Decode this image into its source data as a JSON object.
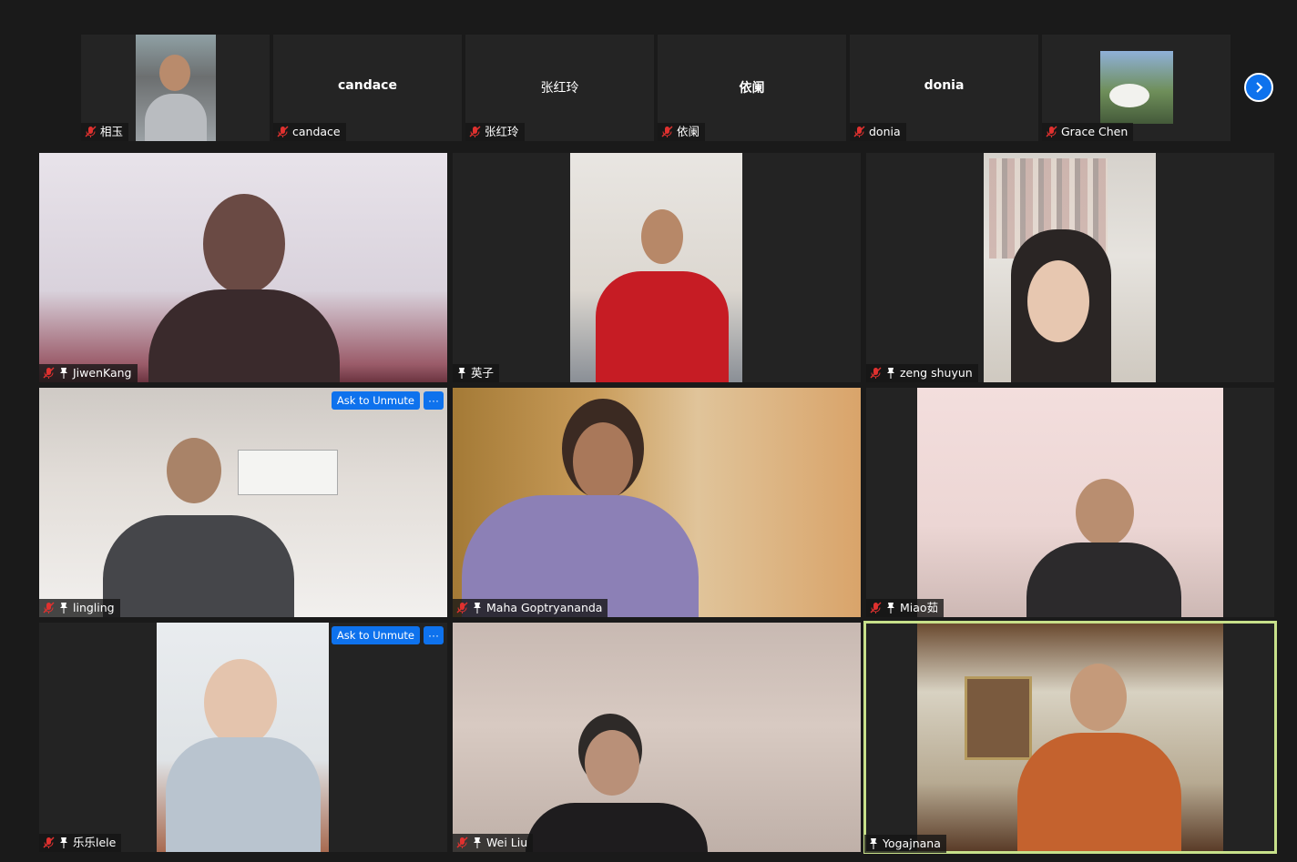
{
  "strip": {
    "tiles": [
      {
        "label": "相玉",
        "display_name": ""
      },
      {
        "label": "candace",
        "display_name": "candace"
      },
      {
        "label": "张红玲",
        "display_name": "张红玲"
      },
      {
        "label": "依阑",
        "display_name": "依阑"
      },
      {
        "label": "donia",
        "display_name": "donia"
      },
      {
        "label": "Grace Chen",
        "display_name": ""
      }
    ],
    "next_icon": "chevron-right-icon"
  },
  "grid": {
    "tiles": [
      {
        "name": "JiwenKang",
        "muted": true,
        "pinned": true
      },
      {
        "name": "英子",
        "muted": false,
        "pinned": true
      },
      {
        "name": "zeng shuyun",
        "muted": true,
        "pinned": true
      },
      {
        "name": "lingling",
        "muted": true,
        "pinned": true,
        "ask_unmute": "Ask to Unmute",
        "more": "···"
      },
      {
        "name": "Maha Goptryananda",
        "muted": true,
        "pinned": true
      },
      {
        "name": "Miao茹",
        "muted": true,
        "pinned": true
      },
      {
        "name": "乐乐lele",
        "muted": true,
        "pinned": true,
        "ask_unmute": "Ask to Unmute",
        "more": "···"
      },
      {
        "name": "Wei Liu",
        "muted": true,
        "pinned": true
      },
      {
        "name": "Yogajnana",
        "muted": false,
        "pinned": true,
        "active_speaker": true
      }
    ]
  },
  "colors": {
    "background": "#1a1a1a",
    "tile": "#232323",
    "accent_blue": "#0e72ed",
    "muted_red": "#e0312f",
    "active_speaker_border": "#c7e08a"
  }
}
